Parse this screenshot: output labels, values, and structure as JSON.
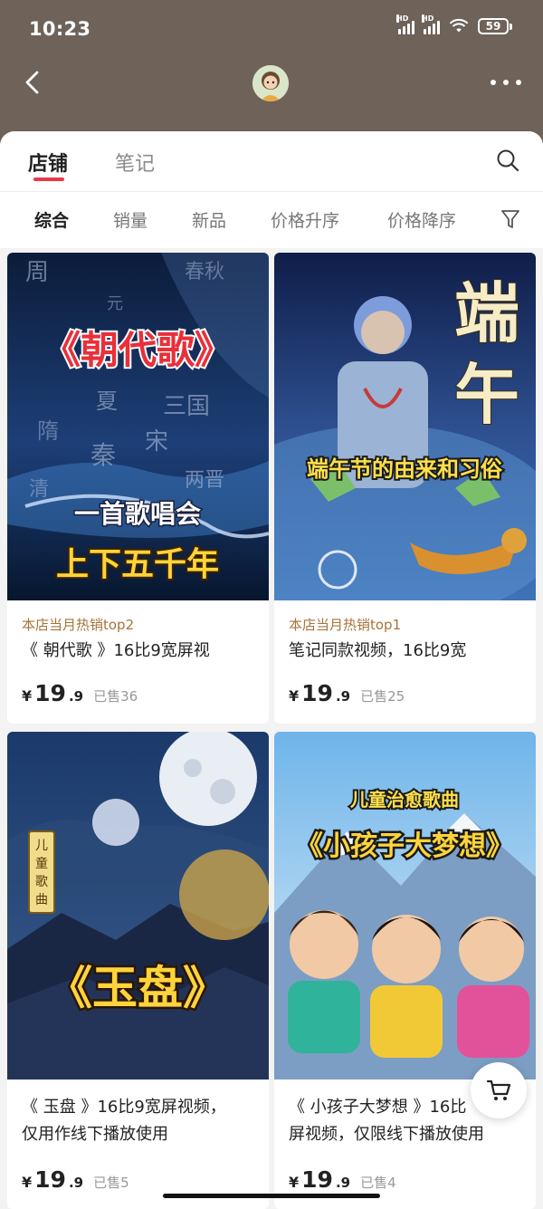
{
  "status_bar": {
    "time": "10:23",
    "battery": "59",
    "hd_label": "HD"
  },
  "tabs": [
    {
      "label": "店铺",
      "active": true
    },
    {
      "label": "笔记",
      "active": false
    }
  ],
  "sort_options": [
    {
      "label": "综合",
      "active": true
    },
    {
      "label": "销量",
      "active": false
    },
    {
      "label": "新品",
      "active": false
    },
    {
      "label": "价格升序",
      "active": false
    },
    {
      "label": "价格降序",
      "active": false
    }
  ],
  "products": [
    {
      "image_text": {
        "title": "《朝代歌》",
        "line1": "一首歌唱会",
        "line2": "上下五千年",
        "bg_words": [
          "周",
          "元",
          "秦",
          "三国",
          "宋",
          "隋",
          "夏",
          "两晋",
          "清",
          "春秋"
        ]
      },
      "hot_label": "本店当月热销top2",
      "title": "《 朝代歌 》16比9宽屏视",
      "title_line2": "",
      "currency": "¥",
      "price_int": "19",
      "price_dec": ".9",
      "sold": "已售36"
    },
    {
      "image_text": {
        "big1": "端",
        "big2": "午",
        "banner": "端午节的由来和习俗"
      },
      "hot_label": "本店当月热销top1",
      "title": "笔记同款视频，16比9宽",
      "title_line2": "",
      "currency": "¥",
      "price_int": "19",
      "price_dec": ".9",
      "sold": "已售25"
    },
    {
      "image_text": {
        "tag": "儿童歌曲",
        "title": "《玉盘》"
      },
      "hot_label": "",
      "title": "《 玉盘 》16比9宽屏视频，",
      "title_line2": "仅用作线下播放使用",
      "currency": "¥",
      "price_int": "19",
      "price_dec": ".9",
      "sold": "已售5"
    },
    {
      "image_text": {
        "subtitle": "儿童治愈歌曲",
        "title": "《小孩子大梦想》"
      },
      "hot_label": "",
      "title": "《 小孩子大梦想 》16比",
      "title_line2": "屏视频，仅限线下播放使用",
      "currency": "¥",
      "price_int": "19",
      "price_dec": ".9",
      "sold": "已售4"
    }
  ],
  "colors": {
    "header": "#6e6259",
    "accent": "#e8394a",
    "hot_label": "#a8733a"
  },
  "icons": [
    "back-arrow-icon",
    "avatar",
    "more-dots-icon",
    "search-icon",
    "filter-icon",
    "cart-icon"
  ]
}
